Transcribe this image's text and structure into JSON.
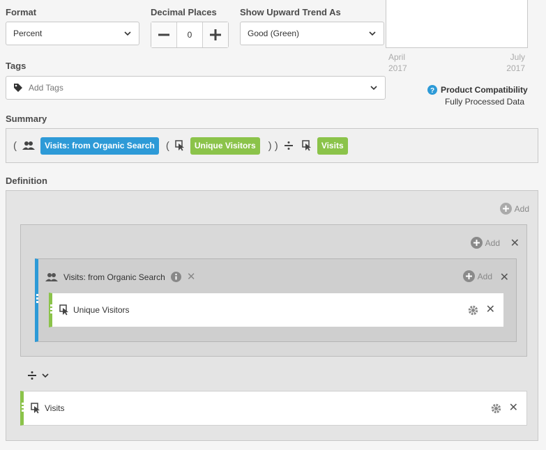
{
  "format": {
    "label": "Format",
    "value": "Percent"
  },
  "decimal": {
    "label": "Decimal Places",
    "value": "0"
  },
  "trend": {
    "label": "Show Upward Trend As",
    "value": "Good (Green)"
  },
  "preview": {
    "start_month": "April",
    "start_year": "2017",
    "end_month": "July",
    "end_year": "2017"
  },
  "tags": {
    "label": "Tags",
    "placeholder": "Add Tags"
  },
  "compat": {
    "title": "Product Compatibility",
    "value": "Fully Processed Data"
  },
  "summary": {
    "label": "Summary",
    "open1": "(",
    "segment": "Visits: from Organic Search",
    "open2": "(",
    "metric1": "Unique Visitors",
    "close": ") )",
    "metric2": "Visits"
  },
  "definition": {
    "label": "Definition",
    "add": "Add",
    "container": {
      "add": "Add"
    },
    "segment_container": {
      "name": "Visits: from Organic Search",
      "add": "Add",
      "metric": "Unique Visitors"
    },
    "operator_row": {
      "metric": "Visits"
    }
  },
  "colors": {
    "blue": "#2d9ad7",
    "green": "#8bc34a"
  }
}
